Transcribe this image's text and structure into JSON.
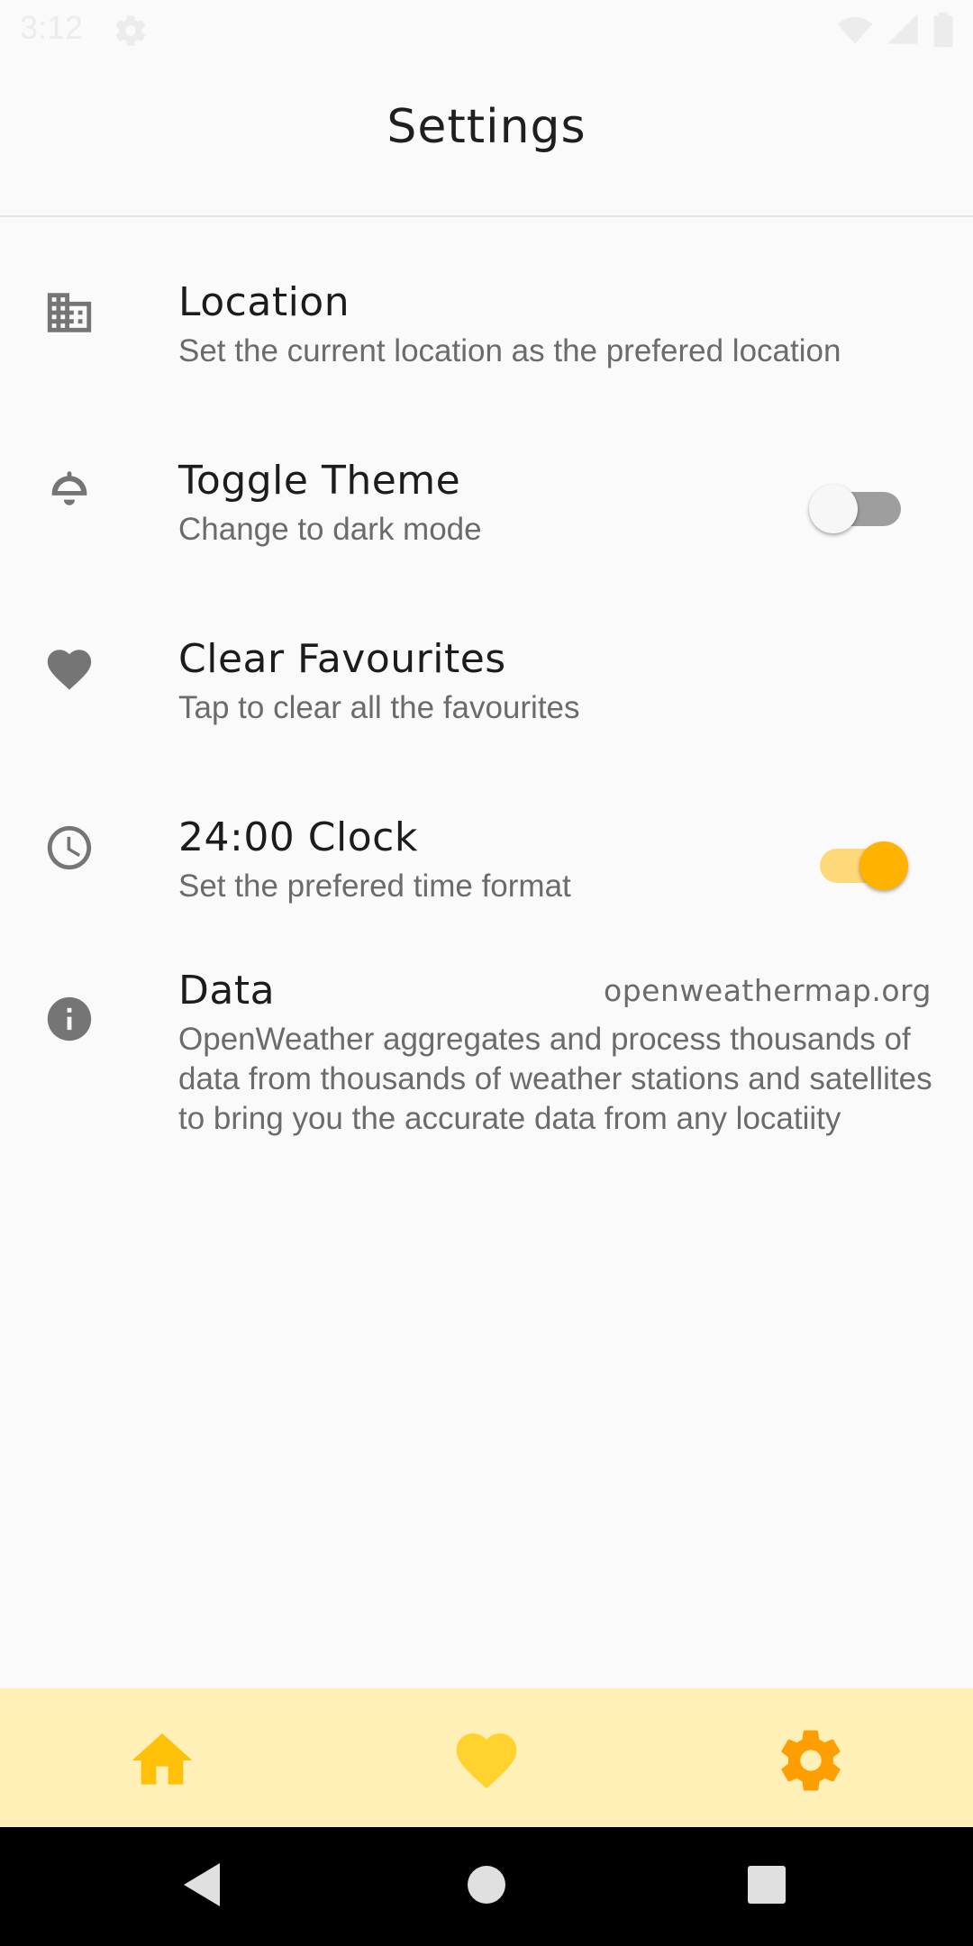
{
  "status_bar": {
    "time": "3:12",
    "left_icon": "gear-icon",
    "right_icons": [
      "wifi-icon",
      "cell-signal-icon",
      "battery-icon"
    ]
  },
  "header": {
    "title": "Settings"
  },
  "settings": {
    "items": [
      {
        "icon": "building-icon",
        "title": "Location",
        "subtitle": "Set the current location as the prefered location"
      },
      {
        "icon": "lamp-icon",
        "title": "Toggle Theme",
        "subtitle": "Change to dark mode",
        "switch_on": false
      },
      {
        "icon": "heart-icon",
        "title": "Clear Favourites",
        "subtitle": "Tap to clear all the favourites"
      },
      {
        "icon": "clock-icon",
        "title": "24:00 Clock",
        "subtitle": "Set the prefered time format",
        "switch_on": true
      },
      {
        "icon": "info-icon",
        "title": "Data",
        "trailing": "openweathermap.org",
        "subtitle": "OpenWeather aggregates and process thousands of data from thousands of weather stations and satellites to bring you the accurate data from any locatiity"
      }
    ]
  },
  "bottom_nav": {
    "items": [
      {
        "icon": "home-icon",
        "color": "#ffc107"
      },
      {
        "icon": "heart-icon",
        "color": "#ffd22e"
      },
      {
        "icon": "gear-icon",
        "color": "#ff9e00",
        "selected": true
      }
    ]
  },
  "colors": {
    "accent": "#ffb300",
    "accent_track": "#ffd87a",
    "nav_background": "#fff0b8",
    "icon_gray": "#757575"
  },
  "system_nav": {
    "buttons": [
      "back-icon",
      "home-circle-icon",
      "recents-icon"
    ]
  }
}
